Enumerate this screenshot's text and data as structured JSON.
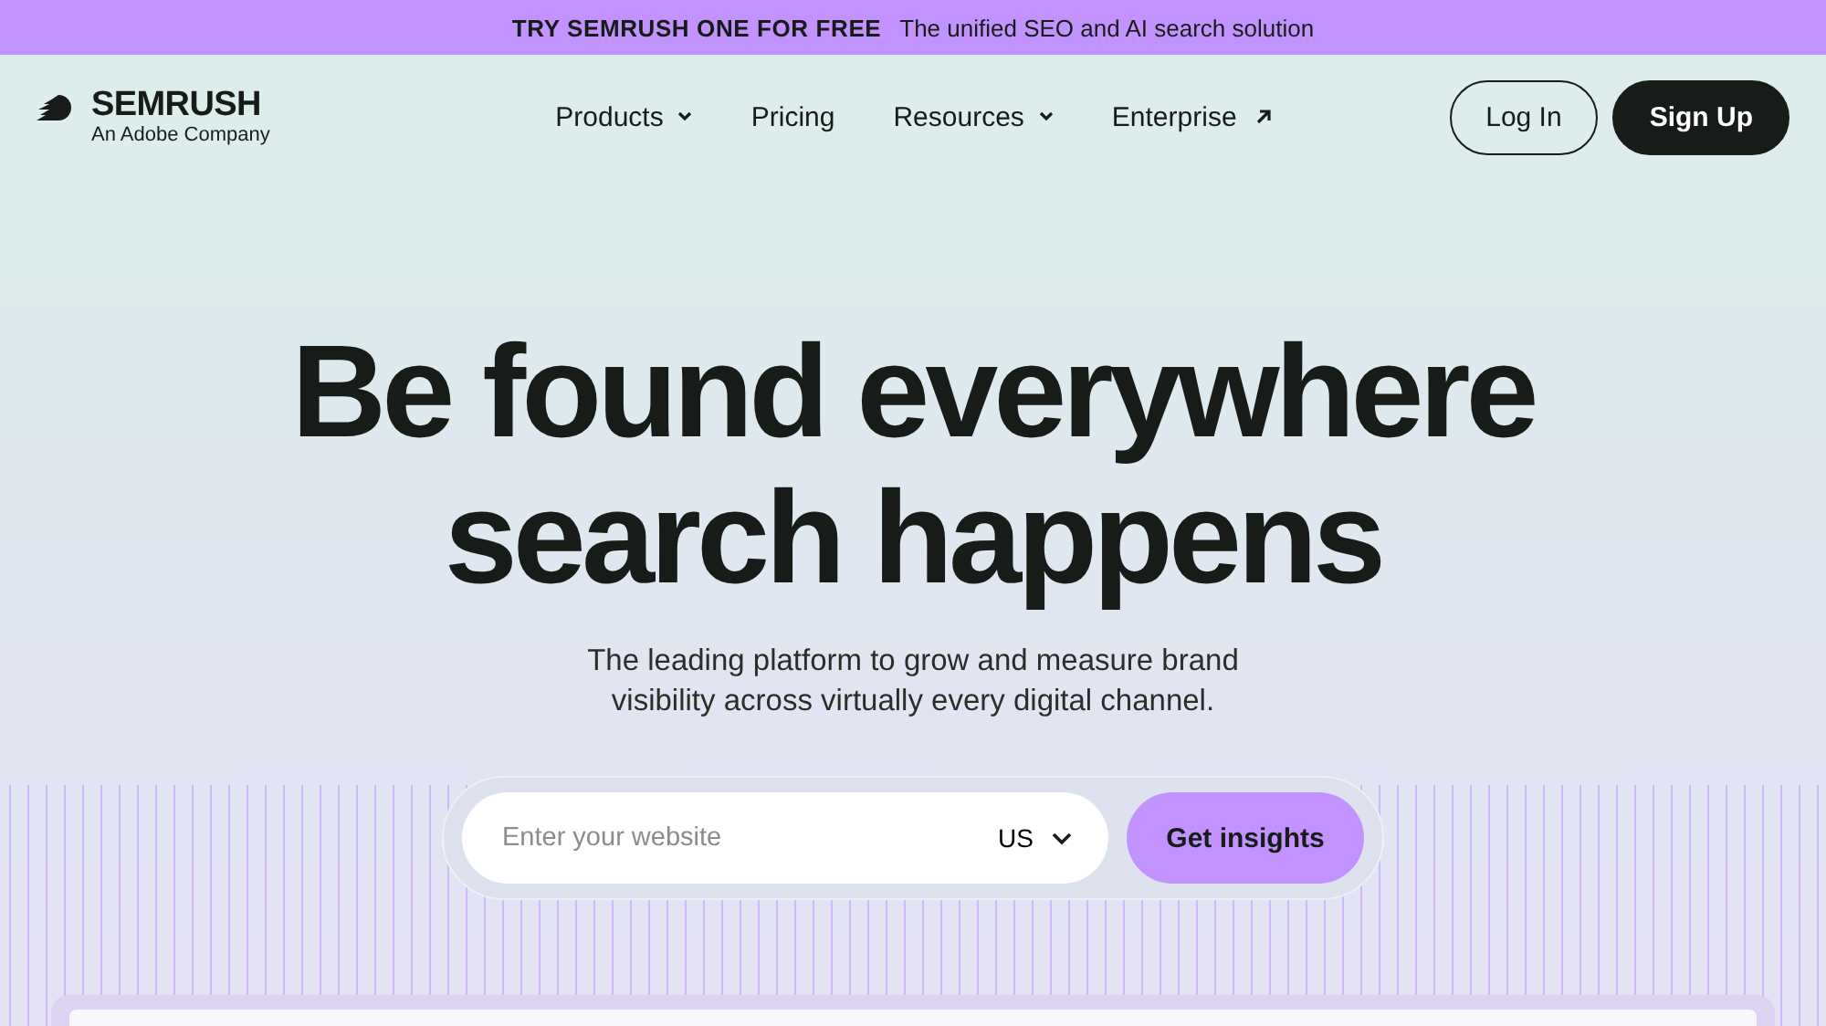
{
  "promo_banner": {
    "cta": "TRY SEMRUSH ONE FOR FREE",
    "text": "The unified SEO and AI search solution"
  },
  "header": {
    "logo": {
      "name": "SEMRUSH",
      "tagline": "An Adobe Company"
    },
    "nav": [
      {
        "label": "Products",
        "kind": "dropdown"
      },
      {
        "label": "Pricing",
        "kind": "link"
      },
      {
        "label": "Resources",
        "kind": "dropdown"
      },
      {
        "label": "Enterprise",
        "kind": "external"
      }
    ],
    "buttons": [
      {
        "label": "Log In",
        "kind": "outline"
      },
      {
        "label": "Sign Up",
        "kind": "solid"
      }
    ]
  },
  "hero": {
    "title_lines": [
      "Be found everywhere",
      "search happens"
    ],
    "subtitle": "The leading platform to grow and measure brand visibility across virtually every digital channel.",
    "search": {
      "placeholder": "Enter your website",
      "country": "US",
      "button": "Get insights"
    }
  }
}
